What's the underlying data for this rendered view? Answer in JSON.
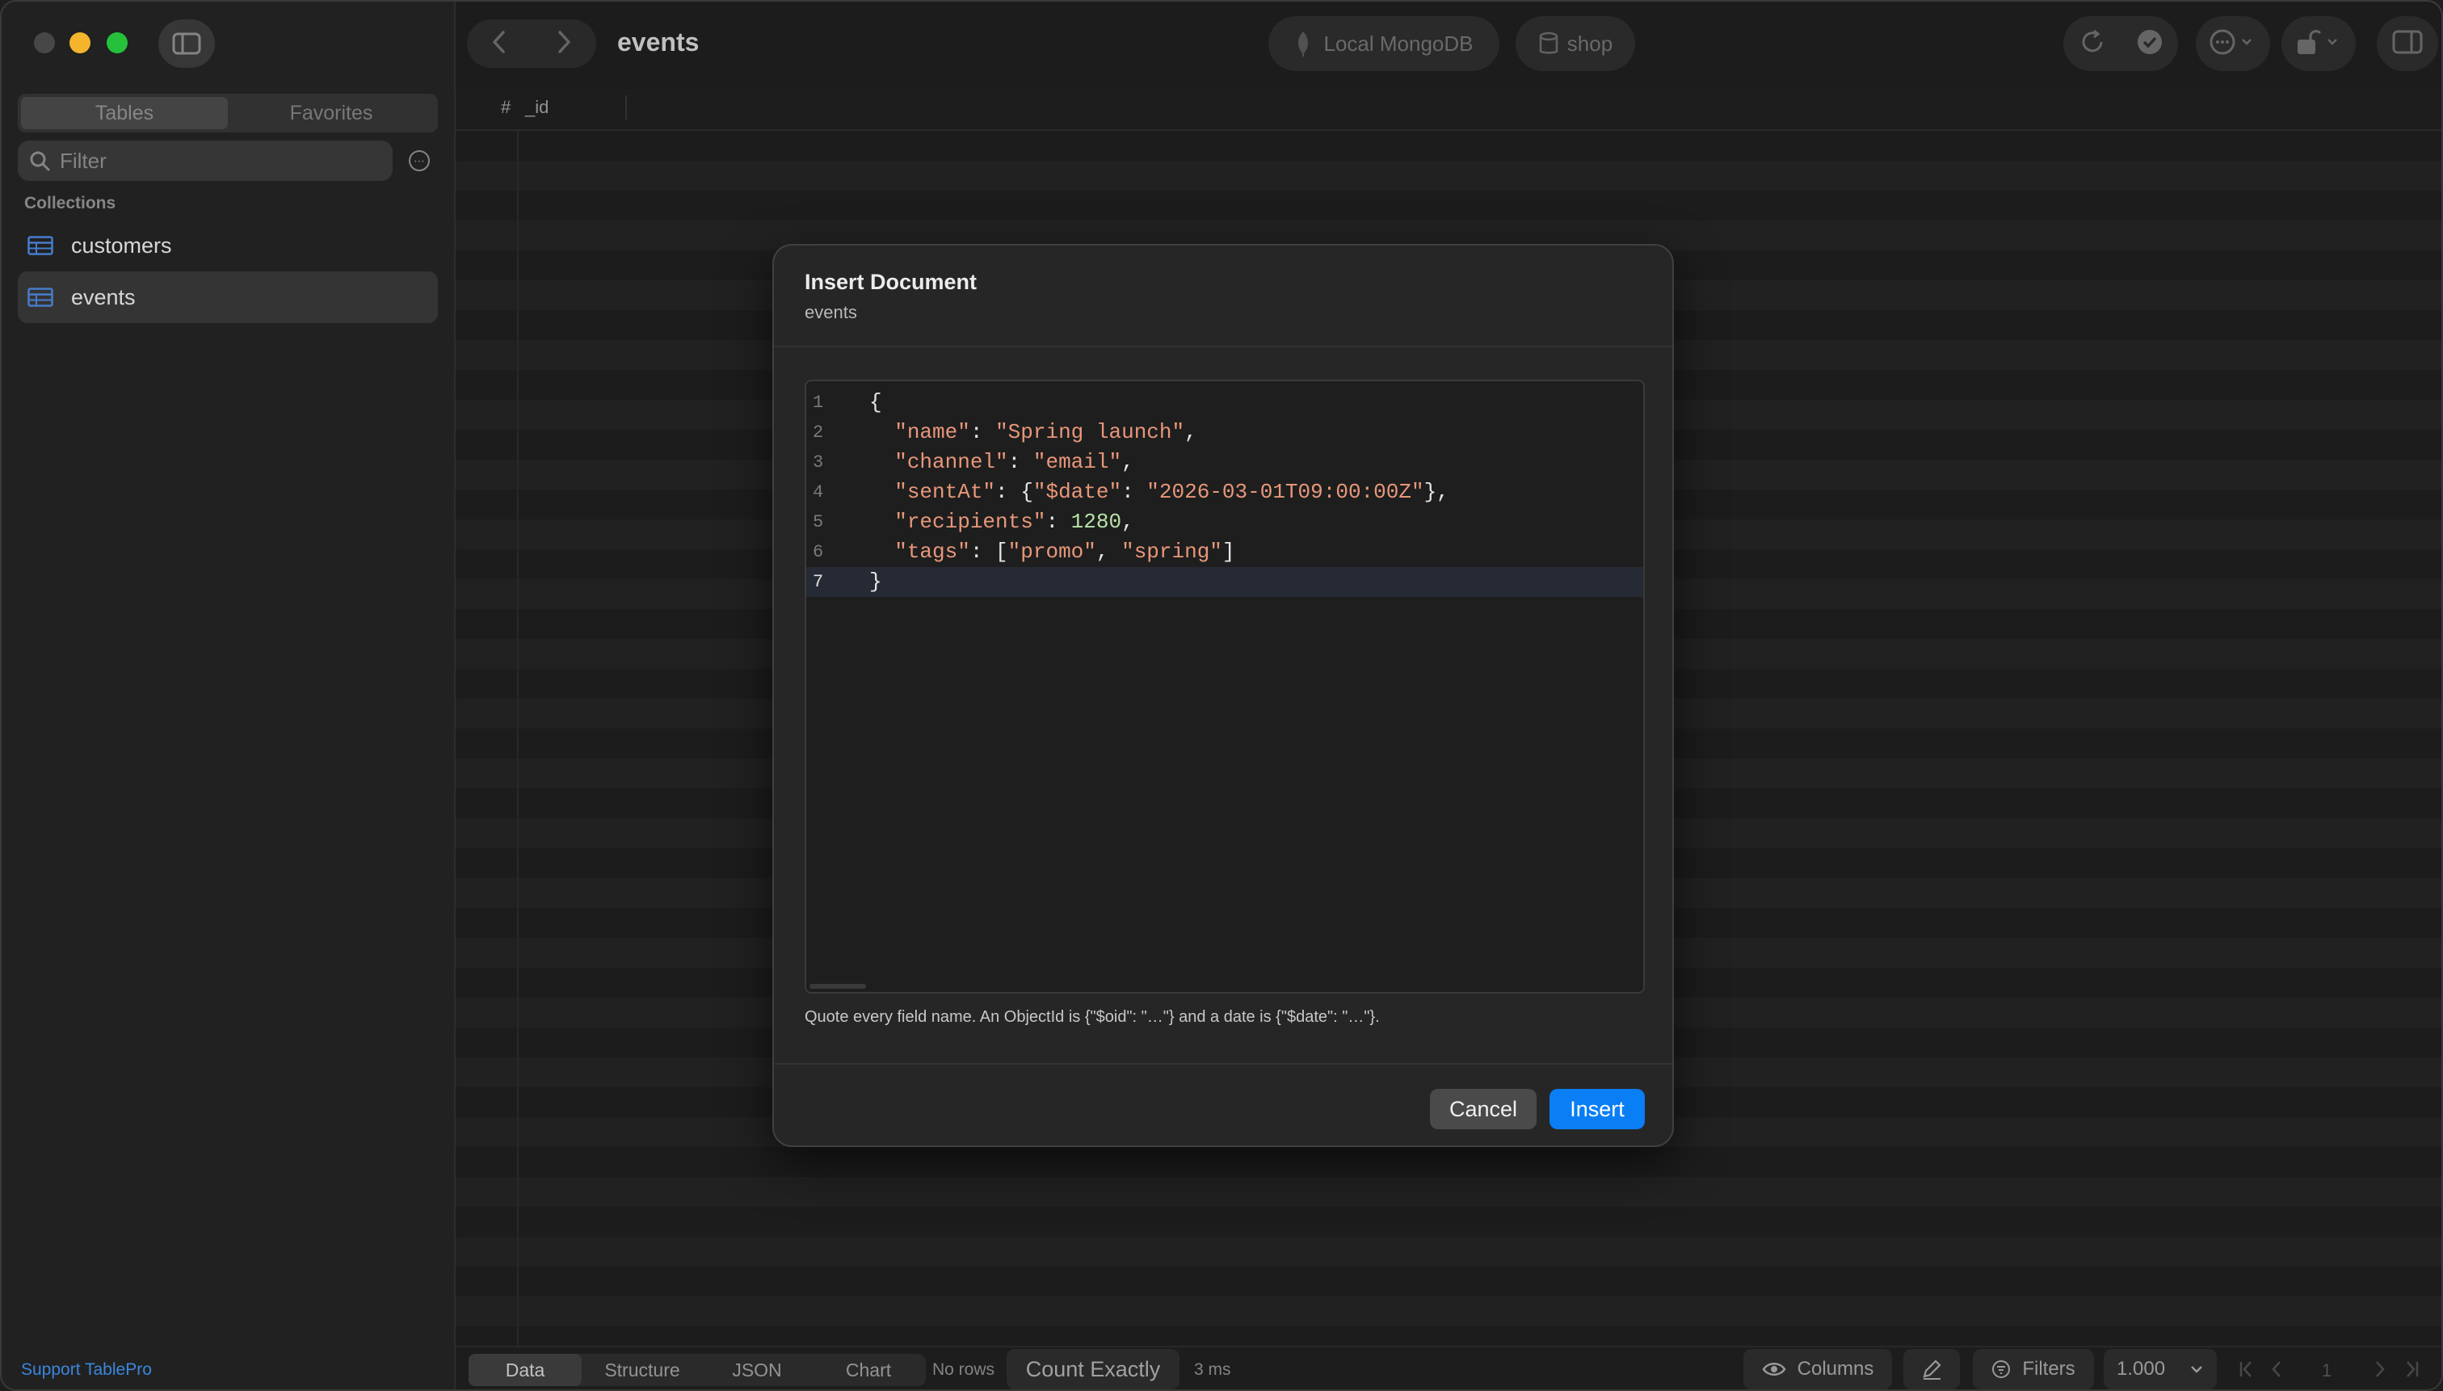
{
  "window": {
    "title": "events"
  },
  "sidebar": {
    "tabs": [
      {
        "label": "Tables",
        "active": true
      },
      {
        "label": "Favorites",
        "active": false
      }
    ],
    "filter": {
      "placeholder": "Filter",
      "value": ""
    },
    "section_label": "Collections",
    "collections": [
      {
        "label": "customers",
        "selected": false
      },
      {
        "label": "events",
        "selected": true
      }
    ],
    "support_link": "Support TablePro"
  },
  "toolbar": {
    "connection": "Local MongoDB",
    "database": "shop",
    "icons": [
      "back-icon",
      "forward-icon",
      "refresh-icon",
      "check-icon",
      "more-icon",
      "lock-icon",
      "panel-icon"
    ]
  },
  "table": {
    "columns": [
      {
        "label": "#"
      },
      {
        "label": "_id"
      }
    ]
  },
  "footer": {
    "views": [
      {
        "label": "Data",
        "active": true
      },
      {
        "label": "Structure",
        "active": false
      },
      {
        "label": "JSON",
        "active": false
      },
      {
        "label": "Chart",
        "active": false
      }
    ],
    "row_status": "No rows",
    "count_button": "Count Exactly",
    "timing": "3 ms",
    "columns_button": "Columns",
    "filters_button": "Filters",
    "page_size": "1.000",
    "page_number": "1"
  },
  "dialog": {
    "title": "Insert Document",
    "subtitle": "events",
    "code_lines": [
      {
        "num": "1",
        "text": "{"
      },
      {
        "num": "2",
        "text": "  \"name\": \"Spring launch\","
      },
      {
        "num": "3",
        "text": "  \"channel\": \"email\","
      },
      {
        "num": "4",
        "text": "  \"sentAt\": {\"$date\": \"2026-03-01T09:00:00Z\"},"
      },
      {
        "num": "5",
        "text": "  \"recipients\": 1280,"
      },
      {
        "num": "6",
        "text": "  \"tags\": [\"promo\", \"spring\"]"
      },
      {
        "num": "7",
        "text": "}"
      }
    ],
    "current_line": "7",
    "hint": "Quote every field name. An ObjectId is {\"$oid\": \"…\"} and a date is {\"$date\": \"…\"}.",
    "cancel_label": "Cancel",
    "insert_label": "Insert"
  },
  "colors": {
    "accent": "#0a7ef5",
    "link": "#3d8ce8",
    "json_string": "#e8977a",
    "json_number": "#b7e3a7"
  }
}
